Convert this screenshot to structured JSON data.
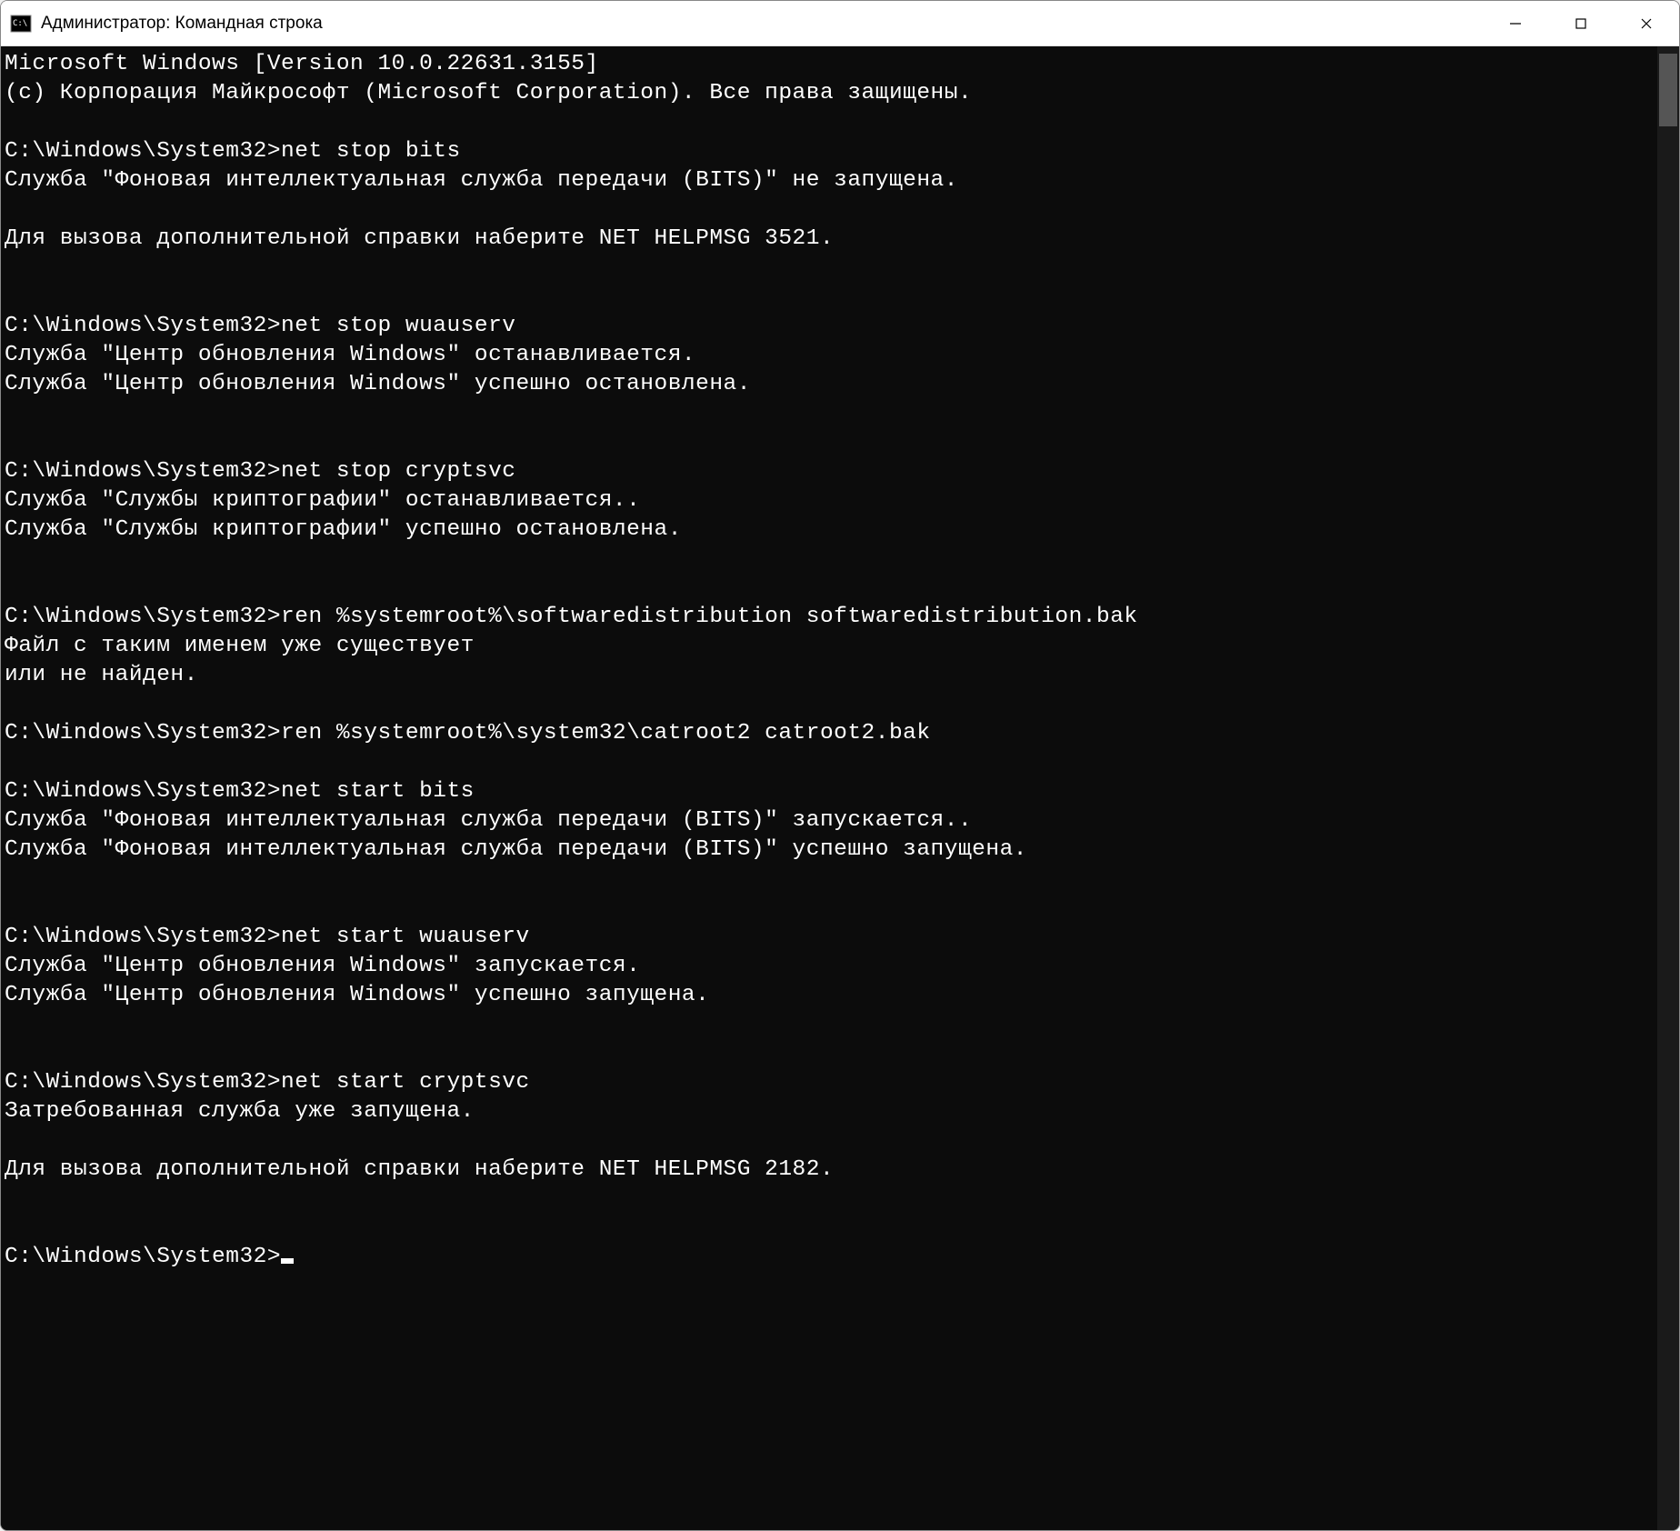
{
  "titlebar": {
    "title": "Администратор: Командная строка"
  },
  "terminal": {
    "lines": [
      "Microsoft Windows [Version 10.0.22631.3155]",
      "(c) Корпорация Майкрософт (Microsoft Corporation). Все права защищены.",
      "",
      "C:\\Windows\\System32>net stop bits",
      "Cлужба \"Фоновая интеллектуальная служба передачи (BITS)\" не запущена.",
      "",
      "Для вызова дополнительной справки наберите NET HELPMSG 3521.",
      "",
      "",
      "C:\\Windows\\System32>net stop wuauserv",
      "Служба \"Центр обновления Windows\" останавливается.",
      "Служба \"Центр обновления Windows\" успешно остановлена.",
      "",
      "",
      "C:\\Windows\\System32>net stop cryptsvc",
      "Служба \"Службы криптографии\" останавливается..",
      "Служба \"Службы криптографии\" успешно остановлена.",
      "",
      "",
      "C:\\Windows\\System32>ren %systemroot%\\softwaredistribution softwaredistribution.bak",
      "Файл с таким именем уже существует",
      "или не найден.",
      "",
      "C:\\Windows\\System32>ren %systemroot%\\system32\\catroot2 catroot2.bak",
      "",
      "C:\\Windows\\System32>net start bits",
      "Служба \"Фоновая интеллектуальная служба передачи (BITS)\" запускается..",
      "Служба \"Фоновая интеллектуальная служба передачи (BITS)\" успешно запущена.",
      "",
      "",
      "C:\\Windows\\System32>net start wuauserv",
      "Служба \"Центр обновления Windows\" запускается.",
      "Служба \"Центр обновления Windows\" успешно запущена.",
      "",
      "",
      "C:\\Windows\\System32>net start cryptsvc",
      "Затребованная служба уже запущена.",
      "",
      "Для вызова дополнительной справки наберите NET HELPMSG 2182.",
      "",
      "",
      "C:\\Windows\\System32>"
    ]
  }
}
